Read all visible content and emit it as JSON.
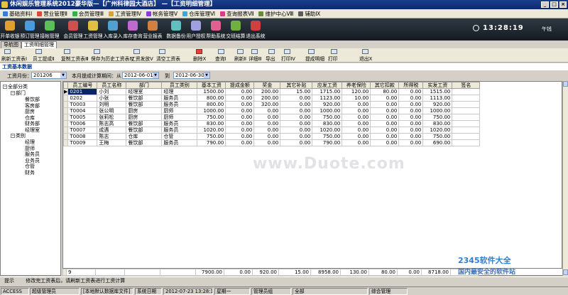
{
  "window": {
    "title": "休闲娱乐管理系统2012豪华版—【广州科律园大酒店】 —【工资明细管理】",
    "min": "_",
    "max": "□",
    "close": "×"
  },
  "menu": [
    "基础资料Ⅰ",
    "营业管理Ⅱ",
    "会员管理Ⅲ",
    "工资管理Ⅳ",
    "帐务管理Ⅴ",
    "仓库管理Ⅵ",
    "查询报表Ⅶ",
    "维护中心Ⅷ",
    "辅助Ⅸ"
  ],
  "menu_colors": [
    "#3b7bd8",
    "#d84a3b",
    "#3bb04a",
    "#d8a03b",
    "#8a3bd8",
    "#3ba8d8",
    "#d83b8a",
    "#6a8a3b",
    "#5a5a5a"
  ],
  "toolbar1": [
    {
      "label": "开单收银",
      "color": "#e0a030",
      "icon": "cash-register-icon"
    },
    {
      "label": "预订管理",
      "color": "#4a9ae0",
      "icon": "calendar-icon"
    },
    {
      "label": "接帐管理",
      "color": "#5ac05a",
      "icon": "ledger-icon"
    },
    {
      "label": "会员管理",
      "color": "#d05050",
      "icon": "member-icon"
    },
    {
      "label": "工资管理",
      "color": "#e0c040",
      "icon": "salary-icon"
    },
    {
      "label": "入库录入",
      "color": "#50a0d0",
      "icon": "stock-in-icon"
    },
    {
      "label": "库存查询",
      "color": "#c06ad0",
      "icon": "inventory-icon"
    },
    {
      "label": "营业报表",
      "color": "#d08040",
      "icon": "report-icon"
    },
    {
      "label": "数据备份",
      "color": "#60c0c0",
      "icon": "backup-icon"
    },
    {
      "label": "用户授权",
      "color": "#a0a0e0",
      "icon": "user-auth-icon"
    },
    {
      "label": "帮助系统",
      "color": "#e06090",
      "icon": "help-icon"
    },
    {
      "label": "交班结算",
      "color": "#70b040",
      "icon": "shift-icon"
    },
    {
      "label": "退出系统",
      "color": "#d04040",
      "icon": "exit-icon"
    }
  ],
  "clock": {
    "time": "13:28:19",
    "weekday": "午钱"
  },
  "tabs": [
    "导航图",
    "工资明细管理"
  ],
  "toolbar2": [
    "刷新工资表Ⅰ",
    "员工提成Ⅱ",
    "复制工资表Ⅲ",
    "保存为历史工资表Ⅳ",
    "工资发放Ⅴ",
    "清空工资表",
    "删除Ⅹ",
    "查询Ⅰ",
    "刷新Ⅱ",
    "详细Ⅲ",
    "导出",
    "打印Ⅳ",
    "提成明细",
    "打印",
    "退出Ⅹ"
  ],
  "section_title": "工资基本数据",
  "filters": {
    "month_label": "工资月份：",
    "month_value": "201206",
    "range_label": "本月提成计算期间：从",
    "from": "2012-06-01",
    "to_label": "到",
    "to": "2012-06-30"
  },
  "tree": {
    "root": "全部分类",
    "dept": "部门",
    "dept_items": [
      "餐饮部",
      "客房部",
      "厨房",
      "仓库",
      "财务部",
      "经理室"
    ],
    "cat": "类别",
    "cat_items": [
      "经理",
      "厨师",
      "服务员",
      "业务员",
      "仓管",
      "财务"
    ]
  },
  "table": {
    "columns": [
      "员工编号",
      "员工名称",
      "部门",
      "员工类别",
      "基本工资",
      "提成金额",
      "奖金",
      "其它补贴",
      "应发工资",
      "养老保险",
      "其它扣款",
      "所得税",
      "实发工资",
      "签名"
    ],
    "rows": [
      [
        "0201",
        "小刘",
        "经理室",
        "经理",
        "1500.00",
        "0.00",
        "200.00",
        "15.00",
        "1715.00",
        "120.00",
        "80.00",
        "0.00",
        "1515.00",
        ""
      ],
      [
        "0202",
        "小张",
        "餐饮部",
        "服务员",
        "800.00",
        "0.00",
        "200.00",
        "0.00",
        "1123.00",
        "10.00",
        "0.00",
        "0.00",
        "1113.00",
        ""
      ],
      [
        "T0003",
        "刘明",
        "餐饮部",
        "服务员",
        "800.00",
        "0.00",
        "320.00",
        "0.00",
        "920.00",
        "0.00",
        "0.00",
        "0.00",
        "920.00",
        ""
      ],
      [
        "T0004",
        "张公明",
        "厨房",
        "厨师",
        "1000.00",
        "0.00",
        "0.00",
        "0.00",
        "1000.00",
        "0.00",
        "0.00",
        "0.00",
        "1000.00",
        ""
      ],
      [
        "T0005",
        "张莉松",
        "厨房",
        "厨师",
        "750.00",
        "0.00",
        "0.00",
        "0.00",
        "750.00",
        "0.00",
        "0.00",
        "0.00",
        "750.00",
        ""
      ],
      [
        "T0006",
        "陈志高",
        "餐饮部",
        "服务员",
        "830.00",
        "0.00",
        "0.00",
        "0.00",
        "830.00",
        "0.00",
        "0.00",
        "0.00",
        "830.00",
        ""
      ],
      [
        "T0007",
        "成遇",
        "餐饮部",
        "服务员",
        "1020.00",
        "0.00",
        "0.00",
        "0.00",
        "1020.00",
        "0.00",
        "0.00",
        "0.00",
        "1020.00",
        ""
      ],
      [
        "T0008",
        "陈志",
        "仓库",
        "仓管",
        "750.00",
        "0.00",
        "0.00",
        "0.00",
        "750.00",
        "0.00",
        "0.00",
        "0.00",
        "750.00",
        ""
      ],
      [
        "T0009",
        "王梅",
        "餐饮部",
        "服务员",
        "790.00",
        "0.00",
        "0.00",
        "0.00",
        "790.00",
        "0.00",
        "0.00",
        "0.00",
        "690.00",
        ""
      ]
    ],
    "footer": [
      "9",
      "",
      "",
      "",
      "7900.00",
      "0.00",
      "920.00",
      "15.00",
      "8958.00",
      "130.00",
      "80.00",
      "0.00",
      "8718.00",
      ""
    ]
  },
  "hint": {
    "label": "提示",
    "text": "修改完工资表后，请刷新工资表进行工资计算"
  },
  "status": [
    "ACCESS",
    "超级管理员",
    "[本地默认数据库文件]",
    "系统日期",
    "2012-07-23  13:28:19",
    "星期一",
    "管理员组",
    "全部",
    "综合管理"
  ],
  "watermark": "www.Duote.com",
  "logo": {
    "brand": "2345软件大全",
    "slogan": "国内最安全的软件站"
  }
}
